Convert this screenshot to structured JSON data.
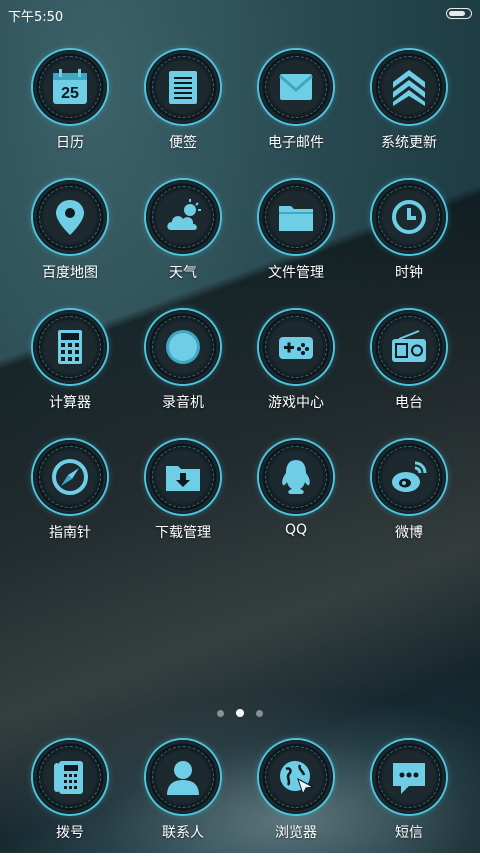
{
  "status": {
    "time": "下午5:50",
    "battery_level": 0.9
  },
  "pager": {
    "pages": 3,
    "current": 2
  },
  "apps": [
    {
      "label": "日历",
      "icon": "calendar-icon",
      "date": "25"
    },
    {
      "label": "便签",
      "icon": "notes-icon"
    },
    {
      "label": "电子邮件",
      "icon": "mail-icon"
    },
    {
      "label": "系统更新",
      "icon": "update-icon"
    },
    {
      "label": "百度地图",
      "icon": "map-pin-icon"
    },
    {
      "label": "天气",
      "icon": "weather-icon"
    },
    {
      "label": "文件管理",
      "icon": "folder-icon"
    },
    {
      "label": "时钟",
      "icon": "clock-icon"
    },
    {
      "label": "计算器",
      "icon": "calculator-icon"
    },
    {
      "label": "录音机",
      "icon": "recorder-icon"
    },
    {
      "label": "游戏中心",
      "icon": "gamepad-icon"
    },
    {
      "label": "电台",
      "icon": "radio-icon"
    },
    {
      "label": "指南针",
      "icon": "compass-icon"
    },
    {
      "label": "下载管理",
      "icon": "download-icon"
    },
    {
      "label": "QQ",
      "icon": "qq-icon"
    },
    {
      "label": "微博",
      "icon": "weibo-icon"
    }
  ],
  "dock": [
    {
      "label": "拨号",
      "icon": "phone-icon"
    },
    {
      "label": "联系人",
      "icon": "contact-icon"
    },
    {
      "label": "浏览器",
      "icon": "browser-icon"
    },
    {
      "label": "短信",
      "icon": "message-icon"
    }
  ],
  "colors": {
    "accent": "#4ec3dc",
    "icon_fill": "#6fcde6"
  }
}
